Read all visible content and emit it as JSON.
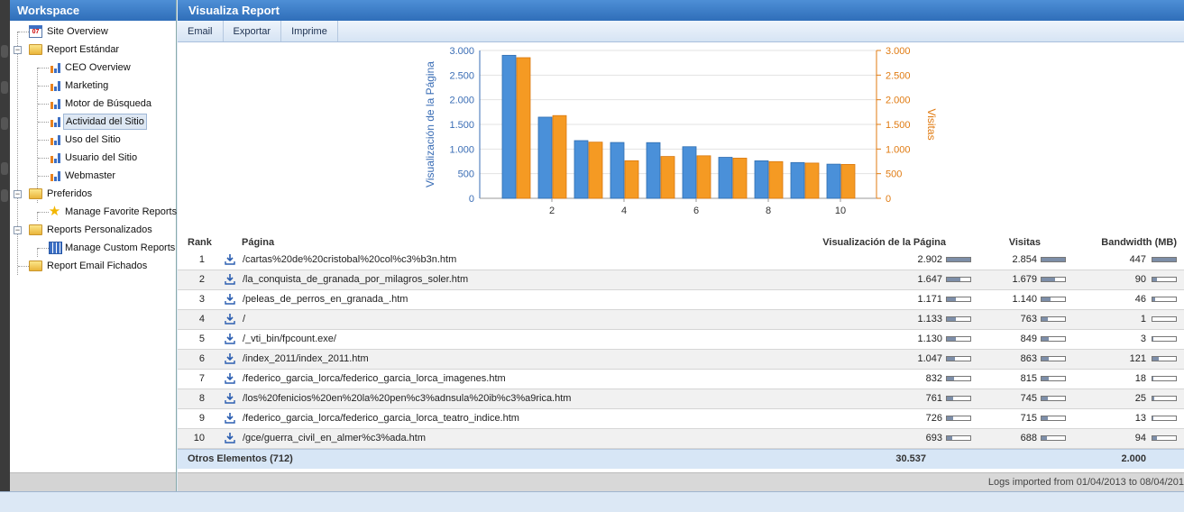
{
  "sidebar": {
    "title": "Workspace",
    "items": [
      {
        "label": "Site Overview",
        "icon": "calendar-icon",
        "cal_text": "07"
      },
      {
        "label": "Report Estándar",
        "icon": "folder-icon"
      },
      {
        "label": "CEO Overview",
        "icon": "bar-chart-icon"
      },
      {
        "label": "Marketing",
        "icon": "bar-chart-icon"
      },
      {
        "label": "Motor de Búsqueda",
        "icon": "bar-chart-icon"
      },
      {
        "label": "Actividad del Sitio",
        "icon": "bar-chart-icon",
        "selected": true
      },
      {
        "label": "Uso del Sitio",
        "icon": "bar-chart-icon"
      },
      {
        "label": "Usuario del Sitio",
        "icon": "bar-chart-icon"
      },
      {
        "label": "Webmaster",
        "icon": "bar-chart-icon"
      },
      {
        "label": "Preferidos",
        "icon": "folder-icon"
      },
      {
        "label": "Manage Favorite Reports",
        "icon": "star-icon"
      },
      {
        "label": "Reports Personalizados",
        "icon": "folder-icon"
      },
      {
        "label": "Manage Custom Reports",
        "icon": "grid-icon"
      },
      {
        "label": "Report Email Fichados",
        "icon": "folder-icon"
      }
    ]
  },
  "main": {
    "title": "Visualiza Report",
    "toolbar": [
      "Email",
      "Exportar",
      "Imprime"
    ]
  },
  "chart_data": {
    "type": "bar",
    "x": [
      1,
      2,
      3,
      4,
      5,
      6,
      7,
      8,
      9,
      10
    ],
    "x_ticks": [
      "2",
      "4",
      "6",
      "8",
      "10"
    ],
    "series": [
      {
        "name": "Visualización de la Página",
        "color": "#4a90d9",
        "values": [
          2902,
          1647,
          1171,
          1133,
          1130,
          1047,
          832,
          761,
          726,
          693
        ]
      },
      {
        "name": "Visitas",
        "color": "#f59a23",
        "values": [
          2854,
          1679,
          1140,
          763,
          849,
          863,
          815,
          745,
          715,
          688
        ]
      }
    ],
    "ylabel_left": "Visualización de la Página",
    "ylabel_right": "Visitas",
    "ylim": [
      0,
      3000
    ],
    "y_ticks": [
      "0",
      "500",
      "1.000",
      "1.500",
      "2.000",
      "2.500",
      "3.000"
    ],
    "grid": true
  },
  "table": {
    "headers": {
      "rank": "Rank",
      "page": "Página",
      "views": "Visualización de la Página",
      "visits": "Visitas",
      "bandwidth": "Bandwidth (MB)"
    },
    "rows": [
      {
        "rank": "1",
        "page": "/cartas%20de%20cristobal%20col%c3%b3n.htm",
        "views": "2.902",
        "visits": "2.854",
        "bandwidth": "447",
        "views_frac": 1.0,
        "visits_frac": 1.0,
        "bw_frac": 1.0
      },
      {
        "rank": "2",
        "page": "/la_conquista_de_granada_por_milagros_soler.htm",
        "views": "1.647",
        "visits": "1.679",
        "bandwidth": "90",
        "views_frac": 0.57,
        "visits_frac": 0.59,
        "bw_frac": 0.2
      },
      {
        "rank": "3",
        "page": "/peleas_de_perros_en_granada_.htm",
        "views": "1.171",
        "visits": "1.140",
        "bandwidth": "46",
        "views_frac": 0.4,
        "visits_frac": 0.4,
        "bw_frac": 0.1
      },
      {
        "rank": "4",
        "page": "/",
        "views": "1.133",
        "visits": "763",
        "bandwidth": "1",
        "views_frac": 0.39,
        "visits_frac": 0.27,
        "bw_frac": 0.0
      },
      {
        "rank": "5",
        "page": "/_vti_bin/fpcount.exe/",
        "views": "1.130",
        "visits": "849",
        "bandwidth": "3",
        "views_frac": 0.39,
        "visits_frac": 0.3,
        "bw_frac": 0.01
      },
      {
        "rank": "6",
        "page": "/index_2011/index_2011.htm",
        "views": "1.047",
        "visits": "863",
        "bandwidth": "121",
        "views_frac": 0.36,
        "visits_frac": 0.3,
        "bw_frac": 0.27
      },
      {
        "rank": "7",
        "page": "/federico_garcia_lorca/federico_garcia_lorca_imagenes.htm",
        "views": "832",
        "visits": "815",
        "bandwidth": "18",
        "views_frac": 0.29,
        "visits_frac": 0.29,
        "bw_frac": 0.04
      },
      {
        "rank": "8",
        "page": "/los%20fenicios%20en%20la%20pen%c3%adnsula%20ib%c3%a9rica.htm",
        "views": "761",
        "visits": "745",
        "bandwidth": "25",
        "views_frac": 0.26,
        "visits_frac": 0.26,
        "bw_frac": 0.06
      },
      {
        "rank": "9",
        "page": "/federico_garcia_lorca/federico_garcia_lorca_teatro_indice.htm",
        "views": "726",
        "visits": "715",
        "bandwidth": "13",
        "views_frac": 0.25,
        "visits_frac": 0.25,
        "bw_frac": 0.03
      },
      {
        "rank": "10",
        "page": "/gce/guerra_civil_en_almer%c3%ada.htm",
        "views": "693",
        "visits": "688",
        "bandwidth": "94",
        "views_frac": 0.24,
        "visits_frac": 0.24,
        "bw_frac": 0.21
      }
    ],
    "others": {
      "label": "Otros Elementos (712)",
      "views": "30.537",
      "bandwidth": "2.000"
    }
  },
  "footer": {
    "logs": "Logs imported from 01/04/2013 to 08/04/201"
  }
}
